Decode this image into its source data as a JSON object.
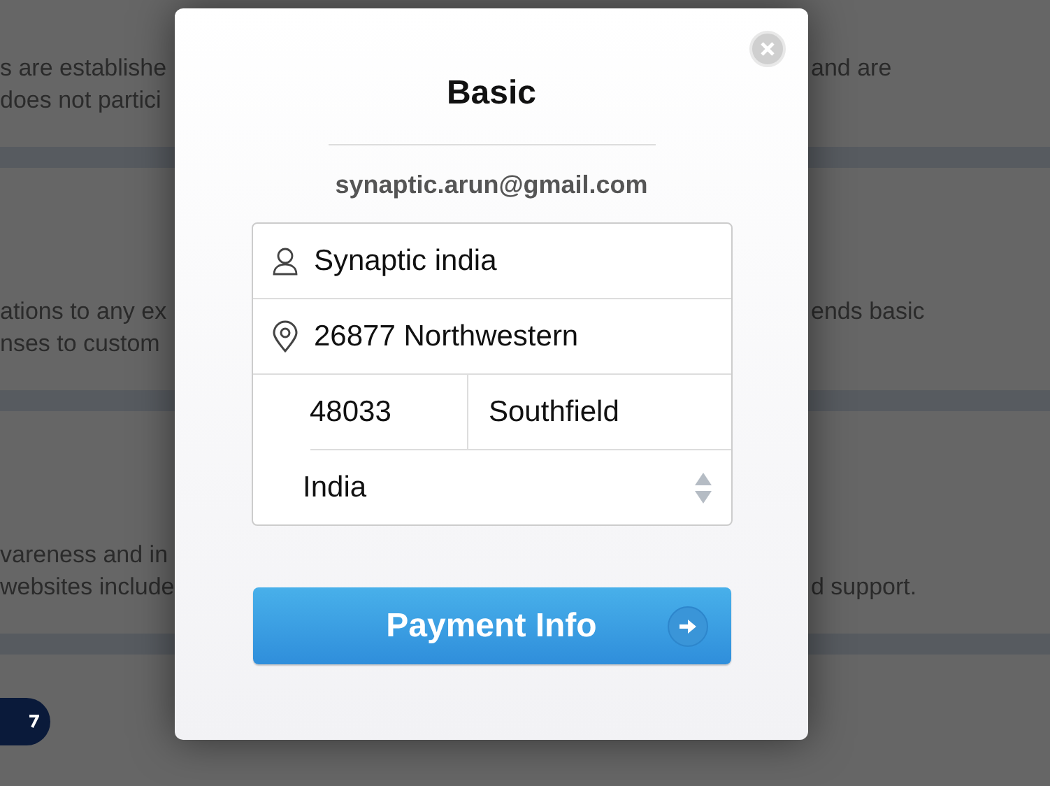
{
  "background": {
    "sections": [
      {
        "lines": [
          {
            "left": "s are establishe",
            "right": "and are"
          },
          {
            "left": "does not partici"
          }
        ]
      },
      {
        "lines": [
          {
            "left": "ations to any ex",
            "right": "ends basic"
          },
          {
            "left": "nses to custom"
          }
        ]
      },
      {
        "lines": [
          {
            "left": "vareness and in"
          },
          {
            "left": "websites include",
            "right": "d support."
          }
        ]
      }
    ]
  },
  "modal": {
    "title": "Basic",
    "email": "synaptic.arun@gmail.com",
    "name": "Synaptic india",
    "address": "26877 Northwestern",
    "zip": "48033",
    "city": "Southfield",
    "country": "India",
    "submit": "Payment Info"
  }
}
